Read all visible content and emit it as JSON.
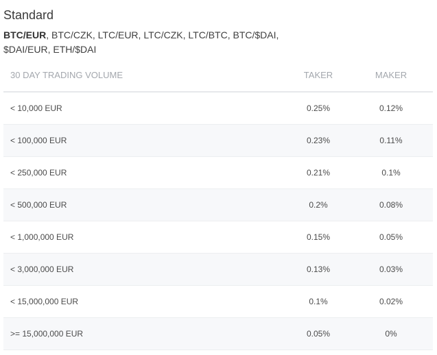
{
  "section": {
    "title": "Standard",
    "pairs_bold": "BTC/EUR",
    "pairs_rest": ", BTC/CZK, LTC/EUR, LTC/CZK, LTC/BTC, BTC/$DAI, $DAI/EUR, ETH/$DAI"
  },
  "table": {
    "headers": {
      "volume": "30 DAY TRADING VOLUME",
      "taker": "TAKER",
      "maker": "MAKER"
    },
    "rows": [
      {
        "volume": "< 10,000 EUR",
        "taker": "0.25%",
        "maker": "0.12%"
      },
      {
        "volume": "< 100,000 EUR",
        "taker": "0.23%",
        "maker": "0.11%"
      },
      {
        "volume": "< 250,000 EUR",
        "taker": "0.21%",
        "maker": "0.1%"
      },
      {
        "volume": "< 500,000 EUR",
        "taker": "0.2%",
        "maker": "0.08%"
      },
      {
        "volume": "< 1,000,000 EUR",
        "taker": "0.15%",
        "maker": "0.05%"
      },
      {
        "volume": "< 3,000,000 EUR",
        "taker": "0.13%",
        "maker": "0.03%"
      },
      {
        "volume": "< 15,000,000 EUR",
        "taker": "0.1%",
        "maker": "0.02%"
      },
      {
        "volume": ">= 15,000,000 EUR",
        "taker": "0.05%",
        "maker": "0%"
      }
    ]
  },
  "colors": {
    "header_text": "#a3a7ad",
    "row_alt_bg": "#f7f8fa",
    "divider": "#eceef0"
  }
}
